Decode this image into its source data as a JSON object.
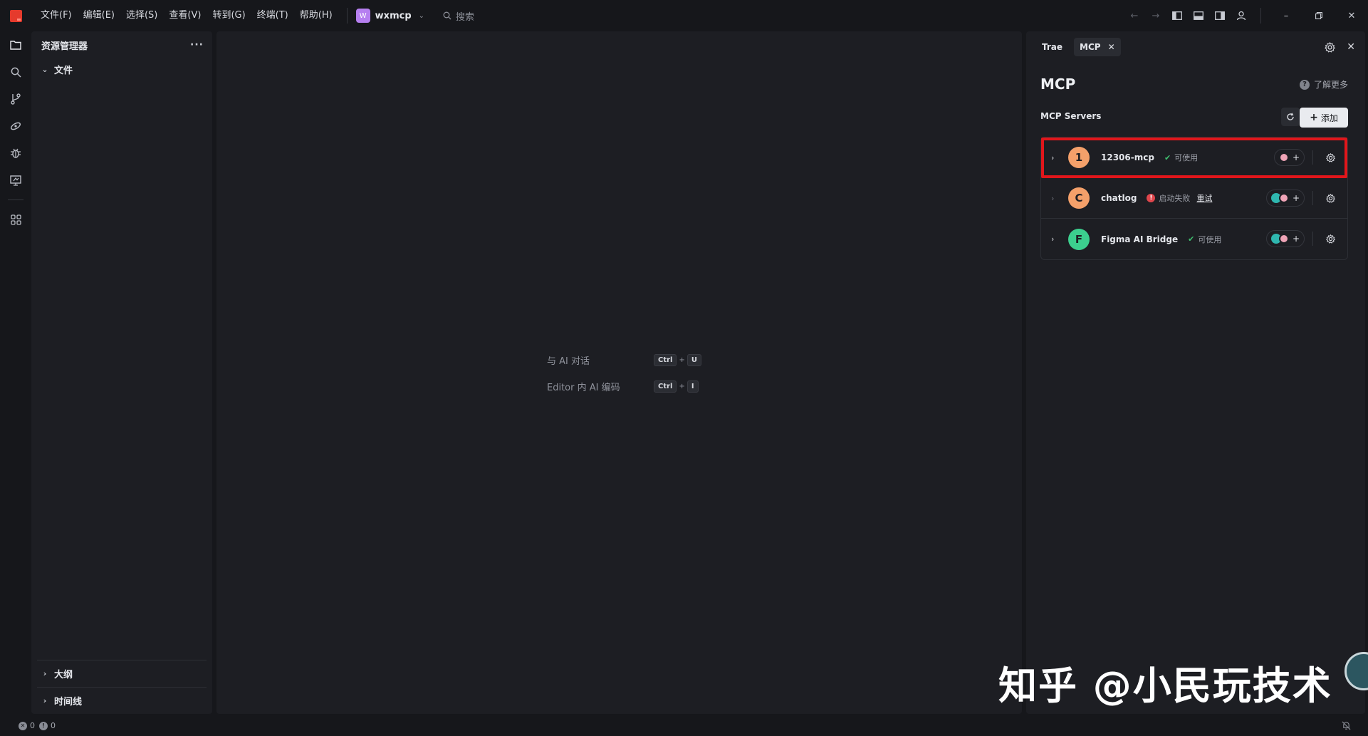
{
  "titlebar": {
    "menu": [
      "文件(F)",
      "编辑(E)",
      "选择(S)",
      "查看(V)",
      "转到(G)",
      "终端(T)",
      "帮助(H)"
    ],
    "workspace_badge": "W",
    "workspace_name": "wxmcp",
    "search_placeholder": "搜索",
    "colors": {
      "logo": "#e53a2c",
      "workspace_badge": "#b67ff0"
    }
  },
  "activity_bar": {
    "items": [
      "explorer-icon",
      "search-icon",
      "source-control-icon",
      "ai-icon",
      "debug-icon",
      "remote-icon",
      "extensions-icon"
    ]
  },
  "explorer": {
    "title": "资源管理器",
    "more": "···",
    "root_folder": "文件",
    "bottom_sections": [
      "大纲",
      "时间线"
    ]
  },
  "editor": {
    "hints": [
      {
        "label": "与 AI 对话",
        "keys": [
          "Ctrl",
          "U"
        ]
      },
      {
        "label": "Editor 内 AI 编码",
        "keys": [
          "Ctrl",
          "I"
        ]
      }
    ]
  },
  "mcp_panel": {
    "tabs": [
      {
        "label": "Trae",
        "active": false
      },
      {
        "label": "MCP",
        "active": true,
        "close": "✕"
      }
    ],
    "title": "MCP",
    "learn_more": "了解更多",
    "learn_more_icon": "?",
    "servers_label": "MCP Servers",
    "add_button": "添加",
    "add_plus": "+",
    "servers": [
      {
        "initial": "1",
        "name": "12306-mcp",
        "status": "可使用",
        "state": "ok",
        "avatar_color": "#f4a06a",
        "highlighted": true,
        "tools": [
          "pink"
        ]
      },
      {
        "initial": "C",
        "name": "chatlog",
        "status": "启动失败",
        "state": "error",
        "retry": "重试",
        "avatar_color": "#f4a06a",
        "highlighted": false,
        "tools": [
          "teal",
          "pink"
        ]
      },
      {
        "initial": "F",
        "name": "Figma AI Bridge",
        "status": "可使用",
        "state": "ok",
        "avatar_color": "#3ccf8e",
        "highlighted": false,
        "tools": [
          "teal",
          "pink"
        ]
      }
    ]
  },
  "statusbar": {
    "errors": "0",
    "warnings": "0",
    "error_glyph": "✕",
    "warning_glyph": "!"
  },
  "watermark": {
    "text": "知乎 @小民玩技术"
  }
}
